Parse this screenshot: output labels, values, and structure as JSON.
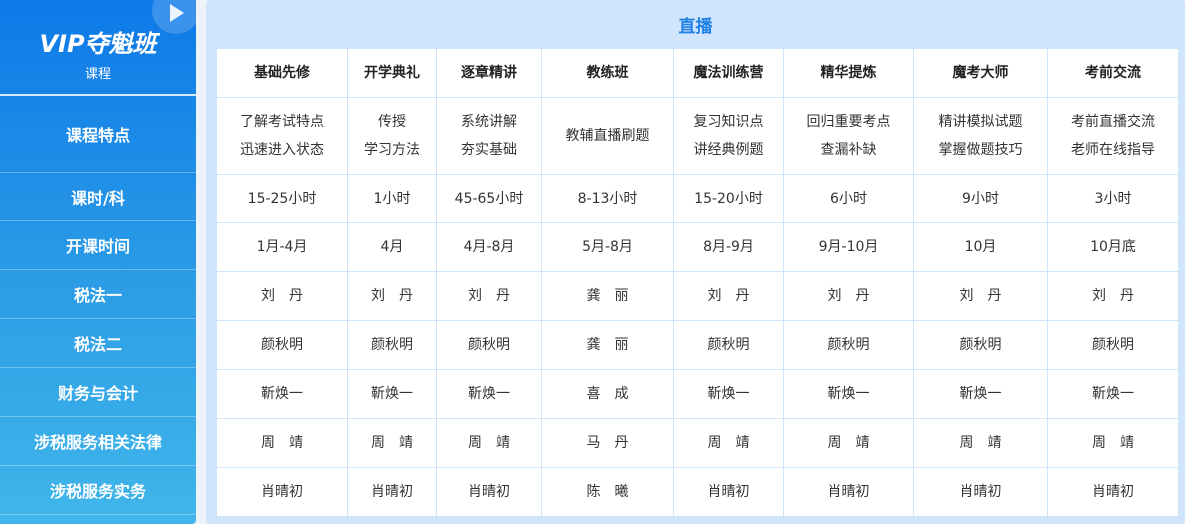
{
  "sidebar": {
    "title": "VIP夺魁班",
    "subtitle": "课程",
    "rows": [
      "课程特点",
      "课时/科",
      "开课时间",
      "税法一",
      "税法二",
      "财务与会计",
      "涉税服务相关法律",
      "涉税服务实务"
    ]
  },
  "panel": {
    "title": "直播"
  },
  "table": {
    "headers": [
      "基础先修",
      "开学典礼",
      "逐章精讲",
      "教练班",
      "魔法训练营",
      "精华提炼",
      "魔考大师",
      "考前交流"
    ],
    "rows": [
      [
        [
          "了解考试特点",
          "迅速进入状态"
        ],
        [
          "传授",
          "学习方法"
        ],
        [
          "系统讲解",
          "夯实基础"
        ],
        [
          "教辅直播刷题"
        ],
        [
          "复习知识点",
          "讲经典例题"
        ],
        [
          "回归重要考点",
          "查漏补缺"
        ],
        [
          "精讲模拟试题",
          "掌握做题技巧"
        ],
        [
          "考前直播交流",
          "老师在线指导"
        ]
      ],
      [
        [
          "15-25小时"
        ],
        [
          "1小时"
        ],
        [
          "45-65小时"
        ],
        [
          "8-13小时"
        ],
        [
          "15-20小时"
        ],
        [
          "6小时"
        ],
        [
          "9小时"
        ],
        [
          "3小时"
        ]
      ],
      [
        [
          "1月-4月"
        ],
        [
          "4月"
        ],
        [
          "4月-8月"
        ],
        [
          "5月-8月"
        ],
        [
          "8月-9月"
        ],
        [
          "9月-10月"
        ],
        [
          "10月"
        ],
        [
          "10月底"
        ]
      ],
      [
        [
          "刘　丹"
        ],
        [
          "刘　丹"
        ],
        [
          "刘　丹"
        ],
        [
          "龚　丽"
        ],
        [
          "刘　丹"
        ],
        [
          "刘　丹"
        ],
        [
          "刘　丹"
        ],
        [
          "刘　丹"
        ]
      ],
      [
        [
          "颜秋明"
        ],
        [
          "颜秋明"
        ],
        [
          "颜秋明"
        ],
        [
          "龚　丽"
        ],
        [
          "颜秋明"
        ],
        [
          "颜秋明"
        ],
        [
          "颜秋明"
        ],
        [
          "颜秋明"
        ]
      ],
      [
        [
          "靳焕一"
        ],
        [
          "靳焕一"
        ],
        [
          "靳焕一"
        ],
        [
          "喜　成"
        ],
        [
          "靳焕一"
        ],
        [
          "靳焕一"
        ],
        [
          "靳焕一"
        ],
        [
          "靳焕一"
        ]
      ],
      [
        [
          "周　靖"
        ],
        [
          "周　靖"
        ],
        [
          "周　靖"
        ],
        [
          "马　丹"
        ],
        [
          "周　靖"
        ],
        [
          "周　靖"
        ],
        [
          "周　靖"
        ],
        [
          "周　靖"
        ]
      ],
      [
        [
          "肖晴初"
        ],
        [
          "肖晴初"
        ],
        [
          "肖晴初"
        ],
        [
          "陈　曦"
        ],
        [
          "肖晴初"
        ],
        [
          "肖晴初"
        ],
        [
          "肖晴初"
        ],
        [
          "肖晴初"
        ]
      ]
    ]
  }
}
